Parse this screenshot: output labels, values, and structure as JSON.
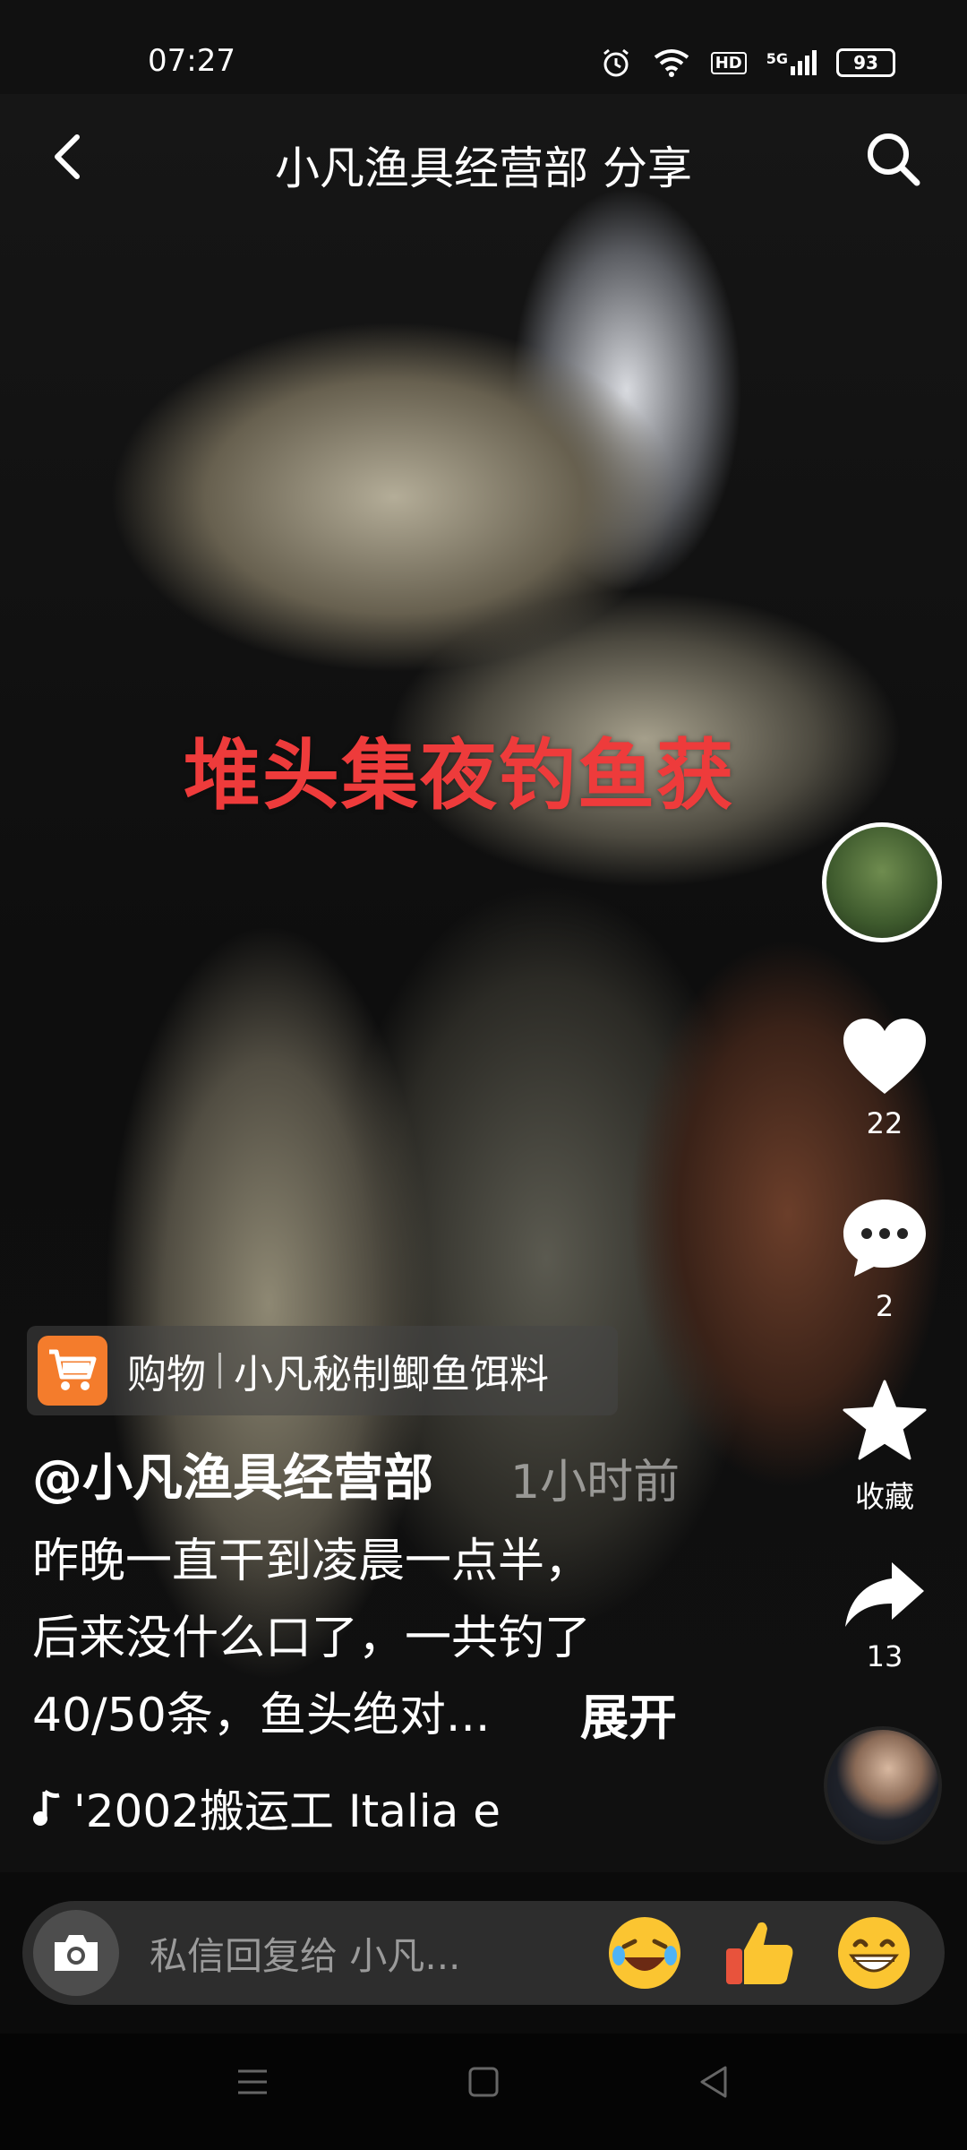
{
  "status_bar": {
    "time": "07:27",
    "network_label": "5G",
    "hd_label": "HD",
    "battery": "93"
  },
  "header": {
    "title": "小凡渔具经营部 分享"
  },
  "video": {
    "overlay_caption": "堆头集夜钓鱼获"
  },
  "rail": {
    "likes": "22",
    "comments": "2",
    "favorite_label": "收藏",
    "shares": "13"
  },
  "product": {
    "shop_label": "购物",
    "name": "小凡秘制鲫鱼饵料"
  },
  "post": {
    "author": "@小凡渔具经营部",
    "time": "1小时前",
    "desc_line1": "昨晚一直干到凌晨一点半，",
    "desc_line2": "后来没什么口了，一共钓了",
    "desc_line3": "40/50条，鱼头绝对...",
    "expand": "展开",
    "music": "'2002搬运工    Italia e"
  },
  "reply": {
    "placeholder": "私信回复给 小凡..."
  },
  "colors": {
    "overlay_red": "#ee3b3b",
    "cart_orange": "#f47c2c"
  }
}
